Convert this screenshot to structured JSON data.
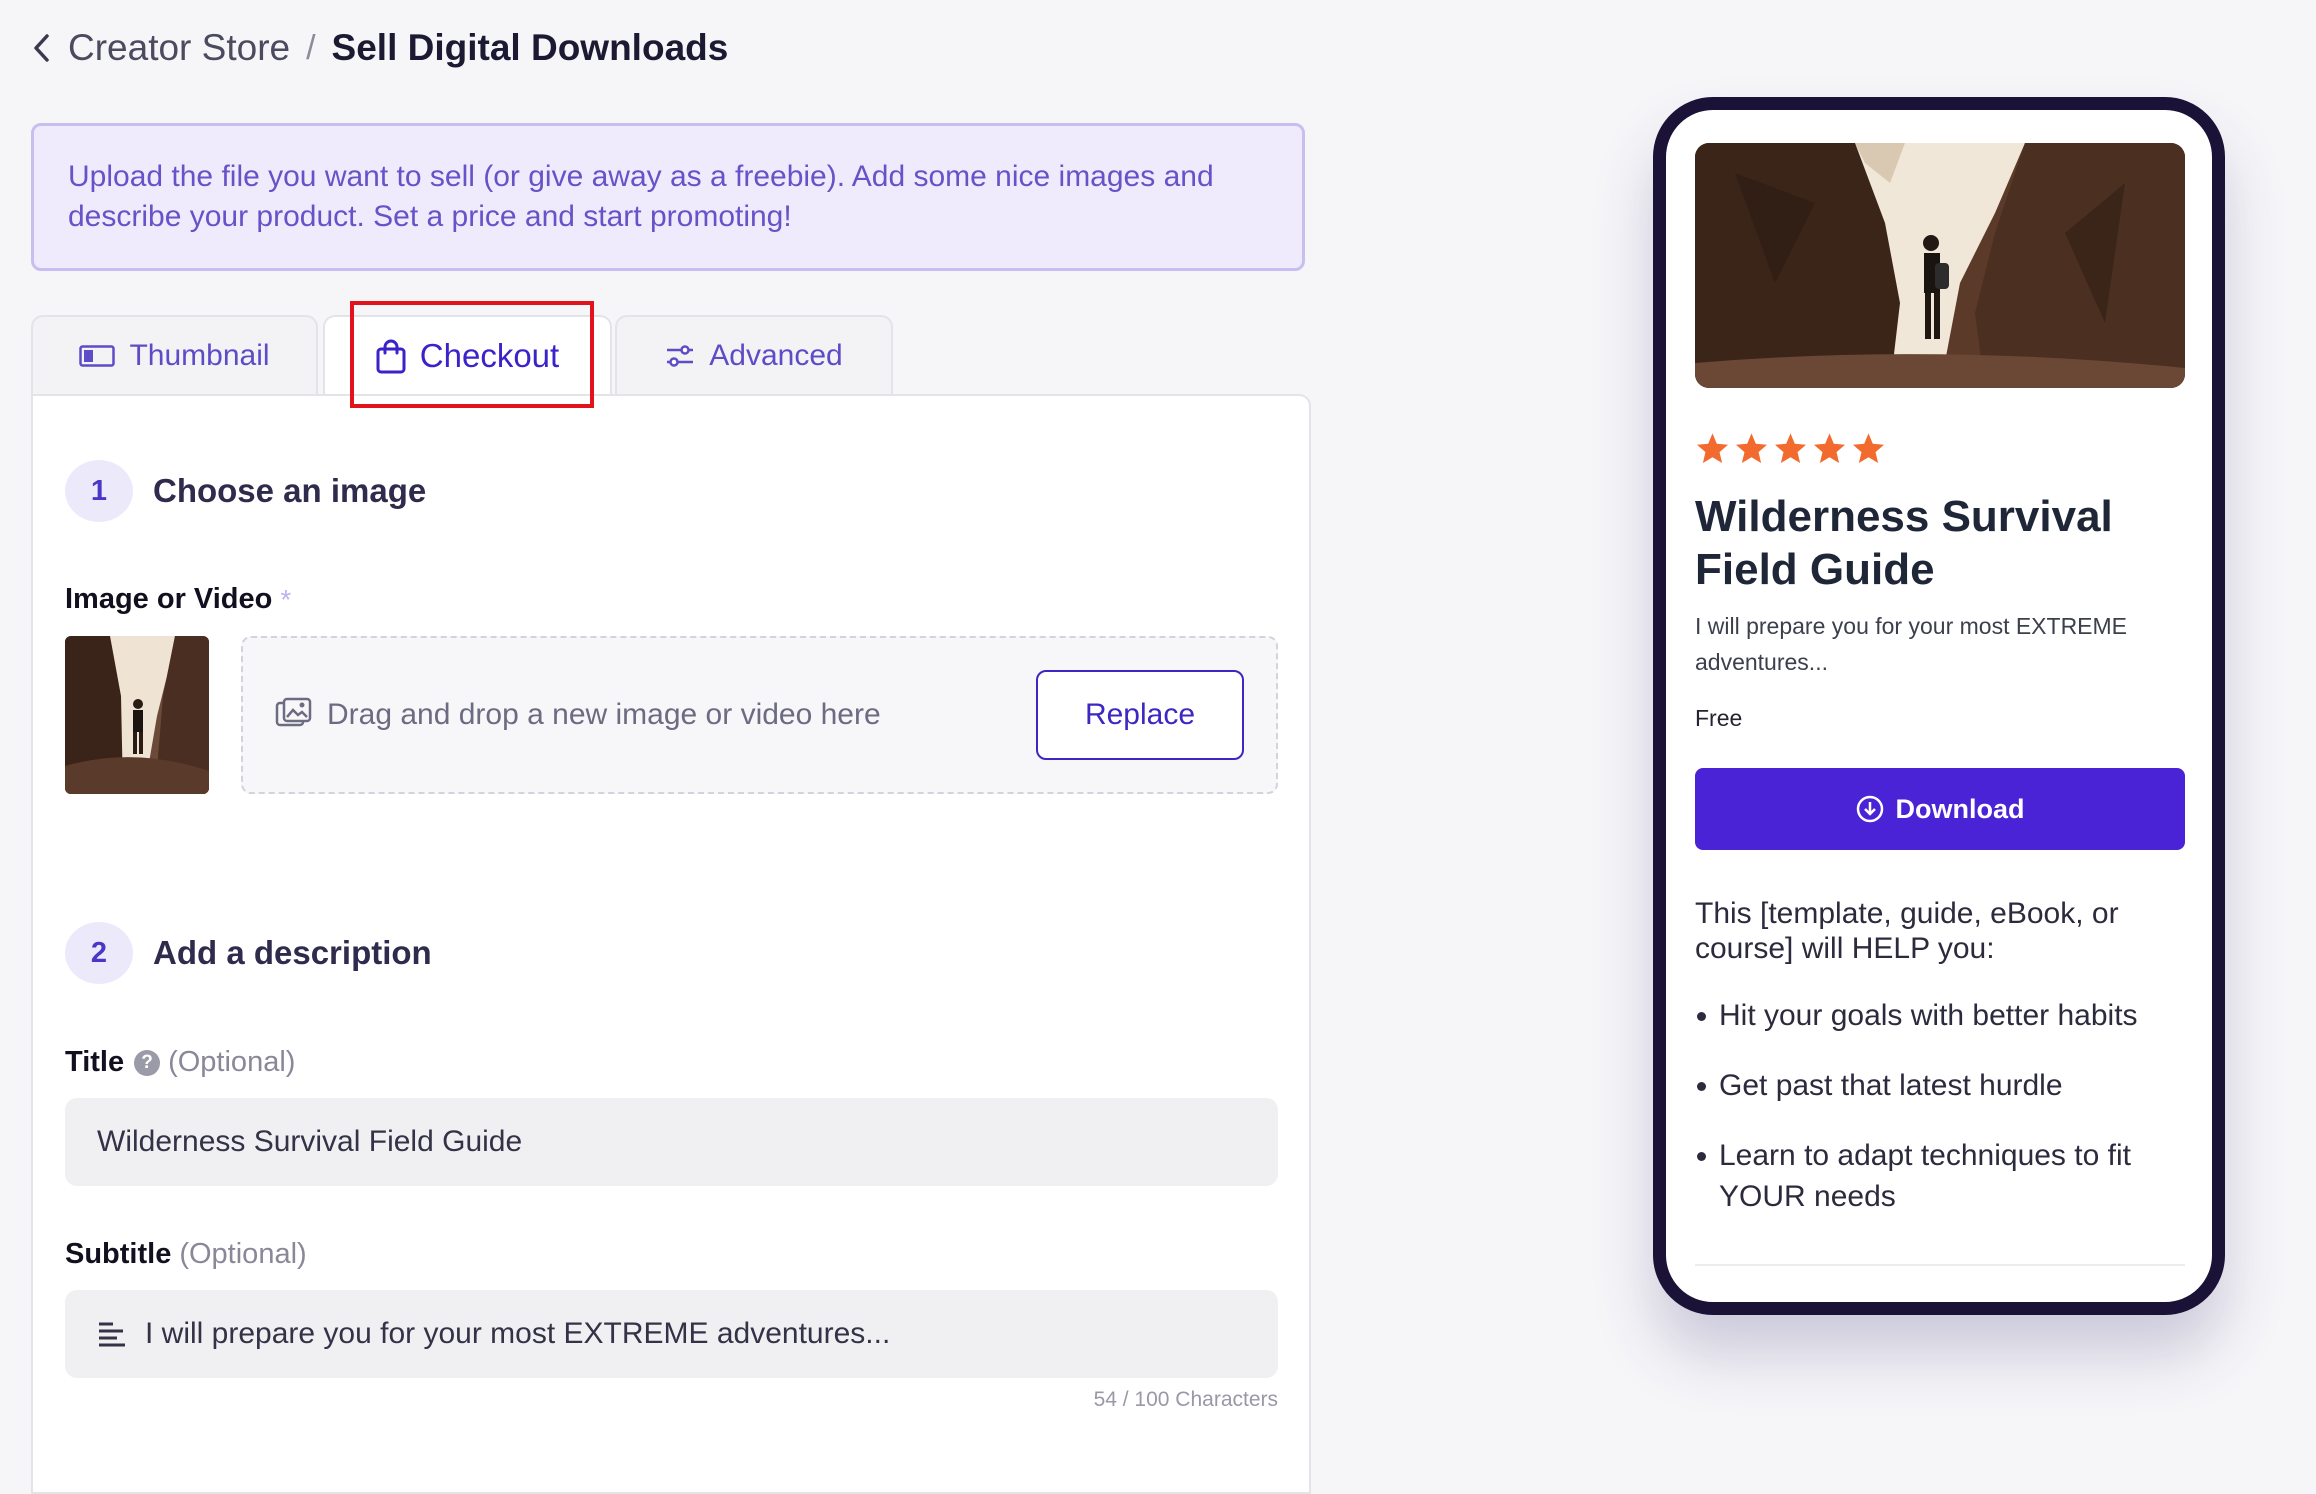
{
  "breadcrumb": {
    "parent": "Creator Store",
    "separator": "/",
    "current": "Sell Digital Downloads"
  },
  "banner": {
    "text": "Upload the file you want to sell (or give away as a freebie). Add some nice images and describe your product. Set a price and start promoting!"
  },
  "tabs": [
    {
      "label": "Thumbnail",
      "icon": "thumbnail-icon",
      "active": false
    },
    {
      "label": "Checkout",
      "icon": "shopping-bag-icon",
      "active": true
    },
    {
      "label": "Advanced",
      "icon": "sliders-icon",
      "active": false
    }
  ],
  "step1": {
    "number": "1",
    "title": "Choose an image"
  },
  "image_field": {
    "label": "Image or Video",
    "required_mark": "*",
    "drop_text": "Drag and drop a new image or video here",
    "replace_label": "Replace"
  },
  "step2": {
    "number": "2",
    "title": "Add a description"
  },
  "title_field": {
    "label": "Title",
    "help": "?",
    "optional": "(Optional)",
    "value": "Wilderness Survival Field Guide"
  },
  "subtitle_field": {
    "label": "Subtitle",
    "optional": "(Optional)",
    "value": "I will prepare you for your most EXTREME adventures...",
    "char_count": "54 / 100 Characters"
  },
  "preview": {
    "rating": 5,
    "title": "Wilderness Survival Field Guide",
    "subtitle": "I will prepare you for your most EXTREME adventures...",
    "price": "Free",
    "button_label": "Download",
    "intro": "This [template, guide, eBook, or course] will HELP you:",
    "bullets": [
      "Hit your goals with better habits",
      "Get past that latest hurdle",
      "Learn to adapt techniques to fit YOUR needs"
    ]
  },
  "colors": {
    "accent": "#4a23d6",
    "star": "#f26a2e",
    "banner_bg": "#efebfd",
    "highlight": "#e0141a"
  }
}
